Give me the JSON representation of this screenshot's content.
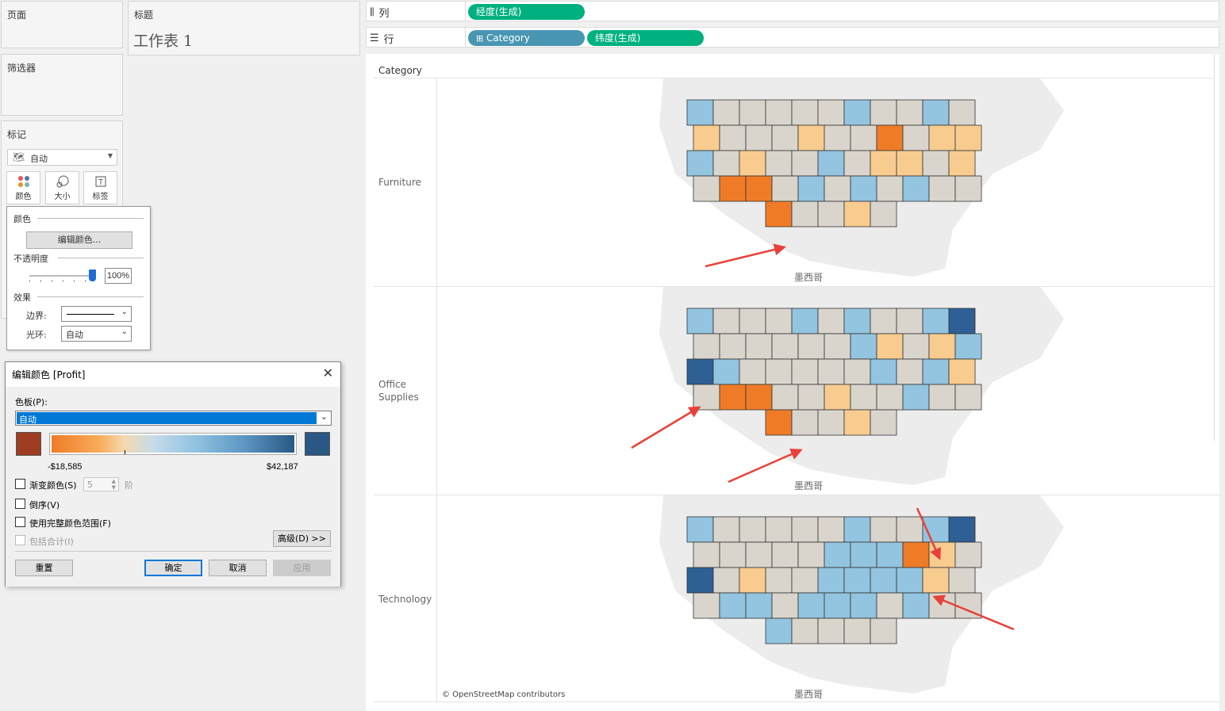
{
  "left_panel": {
    "pages_title": "页面",
    "filters_title": "筛选器",
    "marks_title": "标记",
    "mark_type": "自动",
    "buttons": {
      "color": "颜色",
      "size": "大小",
      "label": "标签"
    }
  },
  "title_card": {
    "heading": "标题",
    "sheet_name": "工作表 1"
  },
  "shelves": {
    "columns_label": "列",
    "rows_label": "行",
    "columns_pill": "经度(生成)",
    "rows_pills": [
      "Category",
      "纬度(生成)"
    ]
  },
  "color_popup": {
    "color_section": "颜色",
    "edit_button": "编辑颜色...",
    "opacity_section": "不透明度",
    "opacity_value": "100%",
    "effects_section": "效果",
    "border_label": "边界:",
    "halo_label": "光环:",
    "halo_value": "自动"
  },
  "dialog": {
    "title": "编辑颜色 [Profit]",
    "palette_label": "色板(P):",
    "palette_value": "自动",
    "min_value": "-$18,585",
    "max_value": "$42,187",
    "min_color": "#9e3d22",
    "max_color": "#2a5783",
    "stepped_label": "渐变颜色(S)",
    "steps_value": "5",
    "steps_suffix": "阶",
    "reverse_label": "倒序(V)",
    "full_range_label": "使用完整颜色范围(F)",
    "include_totals_label": "包括合计(I)",
    "advanced_button": "高级(D) >>",
    "reset_button": "重置",
    "ok_button": "确定",
    "cancel_button": "取消",
    "apply_button": "应用"
  },
  "view": {
    "header": "Category",
    "rows": [
      {
        "label": "Furniture"
      },
      {
        "label": "Office\nSupplies"
      },
      {
        "label": "Technology"
      }
    ],
    "mexico_label": "墨西哥",
    "attribution": "© OpenStreetMap contributors"
  },
  "colors": {
    "orange_dark": "#f07b27",
    "orange_light": "#f8cc8f",
    "blue_dark": "#2e5f95",
    "blue_light": "#93c4e0",
    "neutral": "#d9d5cc",
    "arrow": "#e8413a"
  }
}
